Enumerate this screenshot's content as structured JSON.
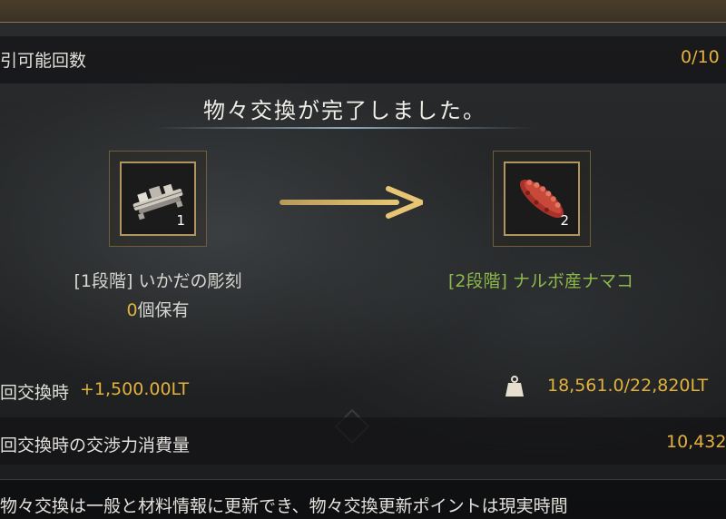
{
  "header": {
    "trade_count_label": "引可能回数",
    "trade_count_value": "0/10"
  },
  "title": "物々交換が完了しました。",
  "exchange": {
    "given_item": {
      "icon": "carving-icon",
      "count": "1",
      "name": "[1段階] いかだの彫刻",
      "owned_value": "0",
      "owned_suffix": "個保有"
    },
    "received_item": {
      "icon": "sea-cucumber-icon",
      "count": "2",
      "name": "[2段階] ナルボ産ナマコ"
    }
  },
  "weight_row": {
    "label": "回交換時",
    "delta": "+1,500.00LT",
    "weight_icon": "weight-icon",
    "weight_value": "18,561.0/22,820LT"
  },
  "energy_row": {
    "label": "回交換時の交渉力消費量",
    "value": "10,432"
  },
  "footer": {
    "text": "物々交換は一般と材料情報に更新でき、物々交換更新ポイントは現実時間"
  },
  "colors": {
    "gold": "#e2b23c",
    "green": "#8db84a",
    "frame": "#b09560"
  }
}
